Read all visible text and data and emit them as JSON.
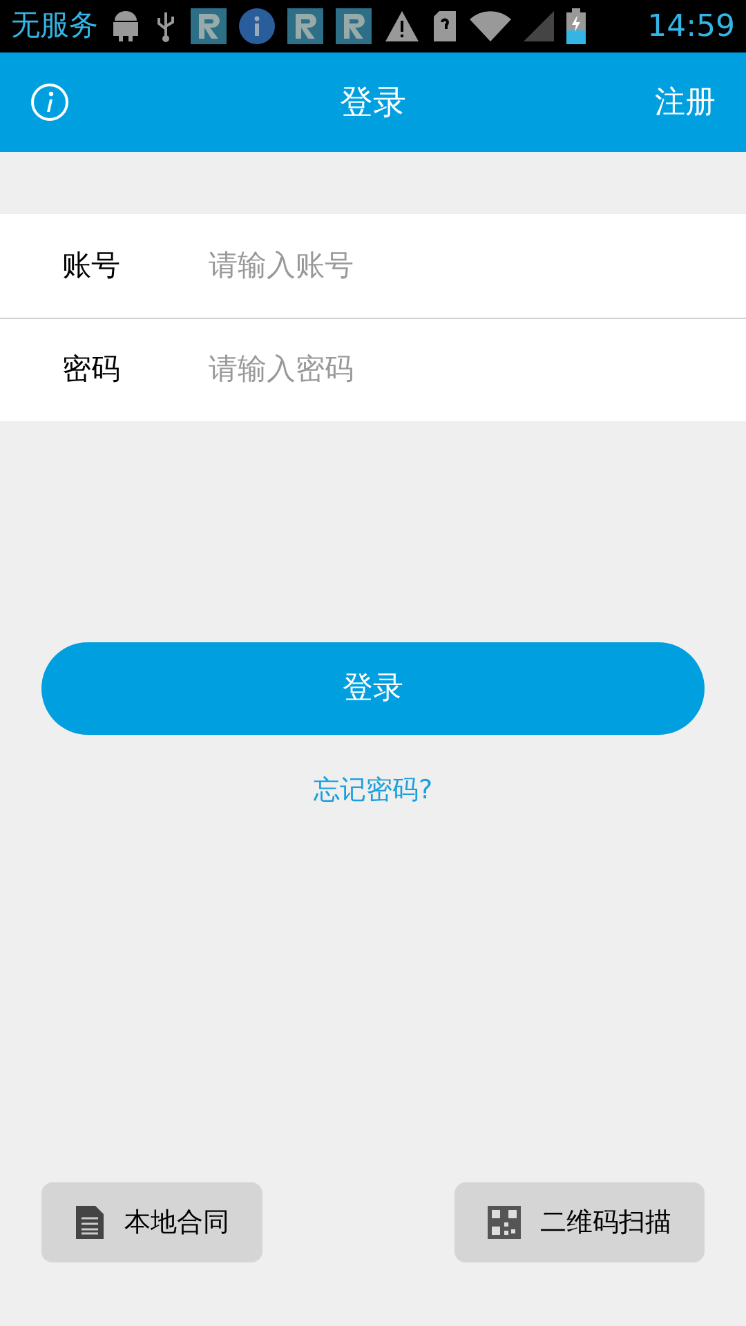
{
  "status_bar": {
    "carrier": "无服务",
    "time": "14:59"
  },
  "header": {
    "title": "登录",
    "action": "注册"
  },
  "form": {
    "fields": [
      {
        "label": "账号",
        "placeholder": "请输入账号"
      },
      {
        "label": "密码",
        "placeholder": "请输入密码"
      }
    ]
  },
  "login_button": "登录",
  "forgot_link": "忘记密码?",
  "bottom_buttons": [
    {
      "kind": "document",
      "label": "本地合同"
    },
    {
      "kind": "qr",
      "label": "二维码扫描"
    }
  ]
}
